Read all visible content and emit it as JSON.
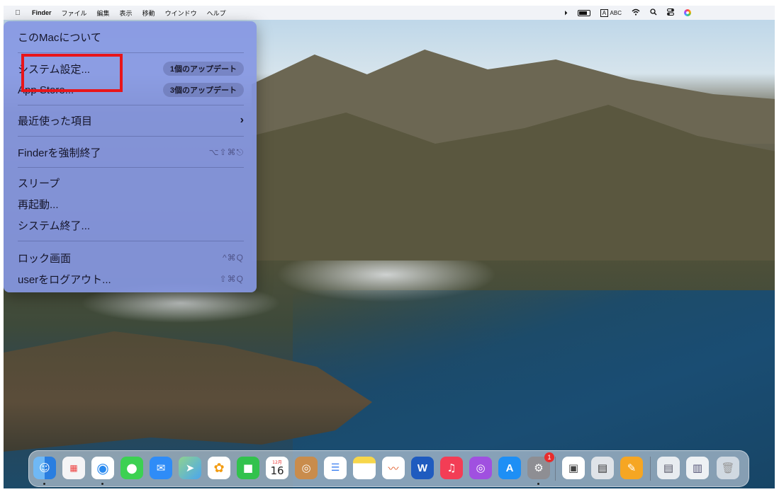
{
  "menubar": {
    "apple_icon": "apple-logo",
    "items": [
      "Finder",
      "ファイル",
      "編集",
      "表示",
      "移動",
      "ウインドウ",
      "ヘルプ"
    ],
    "input_source": "ABC",
    "input_key": "A"
  },
  "apple_menu": {
    "about": "このMacについて",
    "system_settings": "システム設定...",
    "system_settings_badge": "1個のアップデート",
    "app_store": "App Store...",
    "app_store_badge": "3個のアップデート",
    "recent_items": "最近使った項目",
    "force_quit": "Finderを強制終了",
    "force_quit_shortcut": "⌥⇧⌘⎋",
    "sleep": "スリープ",
    "restart": "再起動...",
    "shutdown": "システム終了...",
    "lock_screen": "ロック画面",
    "lock_screen_shortcut": "^⌘Q",
    "logout": "userをログアウト...",
    "logout_shortcut": "⇧⌘Q"
  },
  "dock": {
    "apps": [
      "finder",
      "launchpad",
      "safari",
      "messages",
      "mail",
      "maps",
      "photos",
      "facetime",
      "calendar",
      "contacts",
      "reminders",
      "notes",
      "freeform",
      "word",
      "music",
      "podcasts",
      "app-store",
      "system-settings",
      "preview",
      "image-capture",
      "pages",
      "downloads",
      "trash"
    ],
    "calendar_month": "12月",
    "calendar_day": "16",
    "system_settings_badge": "1"
  },
  "colors": {
    "menu_bg": "#8697e2",
    "highlight": "#e8151a"
  }
}
